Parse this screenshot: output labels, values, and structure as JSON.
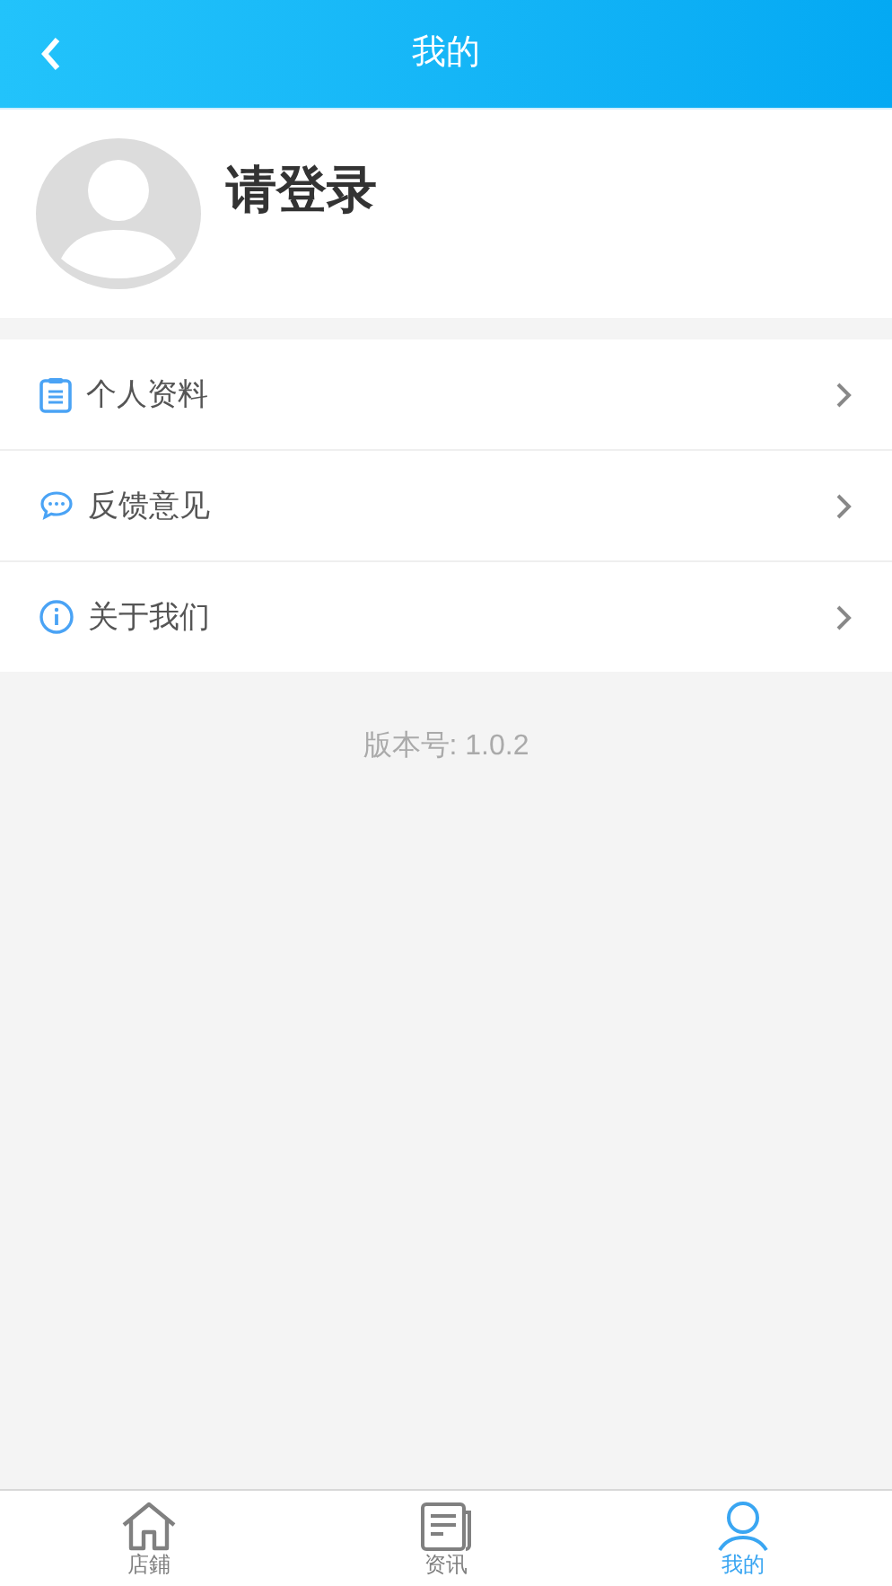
{
  "header": {
    "title": "我的"
  },
  "profile": {
    "name": "请登录"
  },
  "menu": [
    {
      "kind": "document",
      "label": "个人资料"
    },
    {
      "kind": "chat",
      "label": "反馈意见"
    },
    {
      "kind": "info",
      "label": "关于我们"
    }
  ],
  "version": "版本号: 1.0.2",
  "tabs": [
    {
      "kind": "home",
      "label": "店鋪",
      "selected": false
    },
    {
      "kind": "news",
      "label": "资讯",
      "selected": false
    },
    {
      "kind": "user",
      "label": "我的",
      "selected": true
    }
  ]
}
